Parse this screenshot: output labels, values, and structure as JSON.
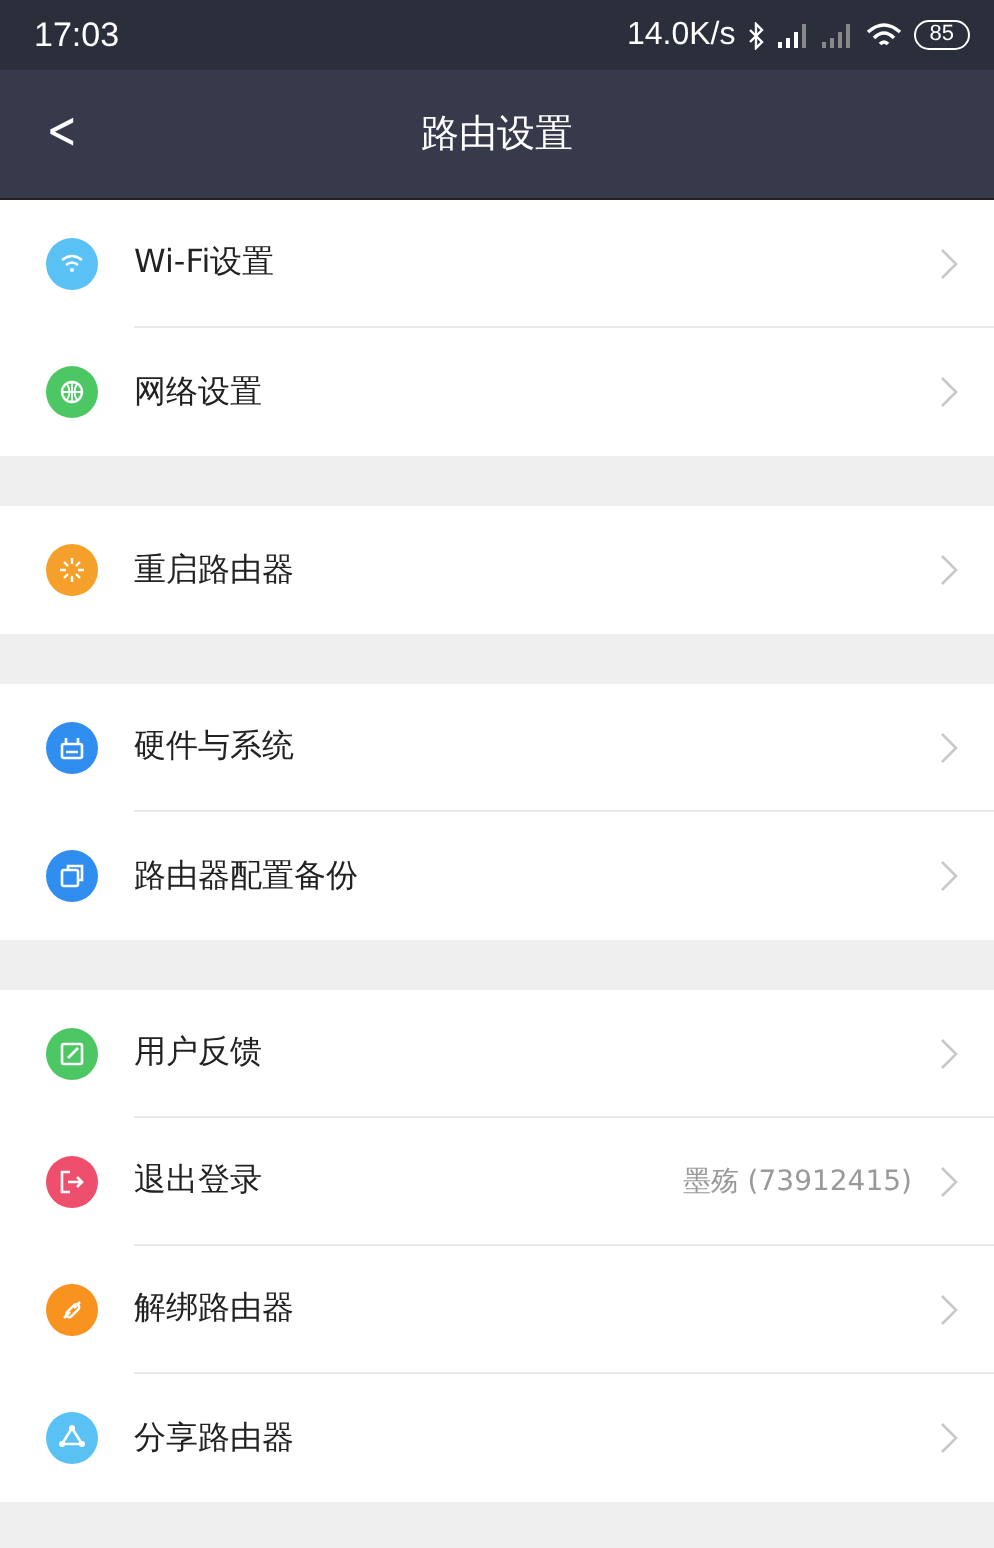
{
  "status_bar": {
    "time": "17:03",
    "speed": "14.0K/s",
    "battery": "85"
  },
  "nav": {
    "back": "<",
    "title": "路由设置"
  },
  "groups": [
    {
      "items": [
        {
          "kind": "wifi",
          "color": "#5ac1f5",
          "label": "Wi-Fi设置"
        },
        {
          "kind": "globe",
          "color": "#4cc764",
          "label": "网络设置"
        }
      ]
    },
    {
      "items": [
        {
          "kind": "restart",
          "color": "#f5a02a",
          "label": "重启路由器"
        }
      ]
    },
    {
      "items": [
        {
          "kind": "device",
          "color": "#2f8ef0",
          "label": "硬件与系统"
        },
        {
          "kind": "backup",
          "color": "#2f8ef0",
          "label": "路由器配置备份"
        }
      ]
    },
    {
      "items": [
        {
          "kind": "edit",
          "color": "#4cc764",
          "label": "用户反馈"
        },
        {
          "kind": "logout",
          "color": "#ee4f6c",
          "label": "退出登录",
          "value": "墨殇 (73912415)"
        },
        {
          "kind": "link",
          "color": "#f7931e",
          "label": "解绑路由器"
        },
        {
          "kind": "share",
          "color": "#5ac1f5",
          "label": "分享路由器"
        }
      ]
    }
  ]
}
